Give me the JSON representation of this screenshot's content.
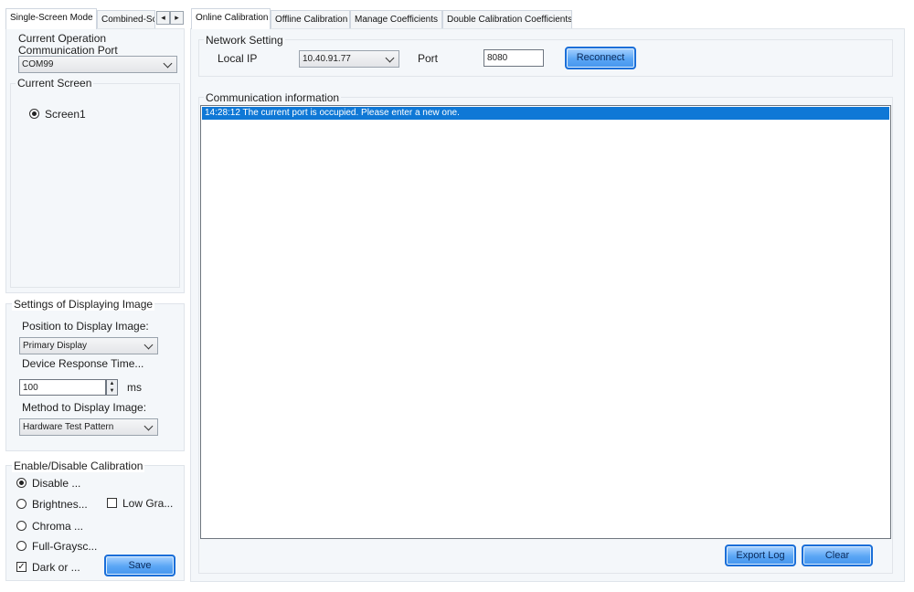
{
  "left_tabs": {
    "items": [
      "Single-Screen Mode",
      "Combined-Sc"
    ],
    "arrows": [
      "◂",
      "▸"
    ]
  },
  "operation": {
    "port_label_line1": "Current Operation",
    "port_label_line2": "Communication Port",
    "port_value": "COM99",
    "screen_label": "Current Screen",
    "screen_option": "Screen1"
  },
  "display_settings": {
    "title": "Settings of Displaying Image",
    "position_label": "Position to Display Image:",
    "position_value": "Primary Display",
    "response_label": "Device Response Time...",
    "response_value": "100",
    "response_unit": "ms",
    "method_label": "Method to Display Image:",
    "method_value": "Hardware Test Pattern"
  },
  "calibration": {
    "title": "Enable/Disable Calibration",
    "options": [
      "Disable ...",
      "Brightnes...",
      "Chroma ...",
      "Full-Graysc..."
    ],
    "low_gray_label": "Low Gra...",
    "dark_label": "Dark or ...",
    "save_label": "Save"
  },
  "right_tabs": {
    "items": [
      "Online Calibration",
      "Offline Calibration",
      "Manage Coefficients",
      "Double Calibration Coefficients"
    ]
  },
  "network": {
    "title": "Network Setting",
    "local_ip_label": "Local IP",
    "local_ip_value": "10.40.91.77",
    "port_label": "Port",
    "port_value": "8080",
    "reconnect_label": "Reconnect"
  },
  "communication": {
    "title": "Communication information",
    "log_entries": [
      "14:28:12  The current port is occupied. Please enter a new one."
    ],
    "export_label": "Export Log",
    "clear_label": "Clear"
  }
}
